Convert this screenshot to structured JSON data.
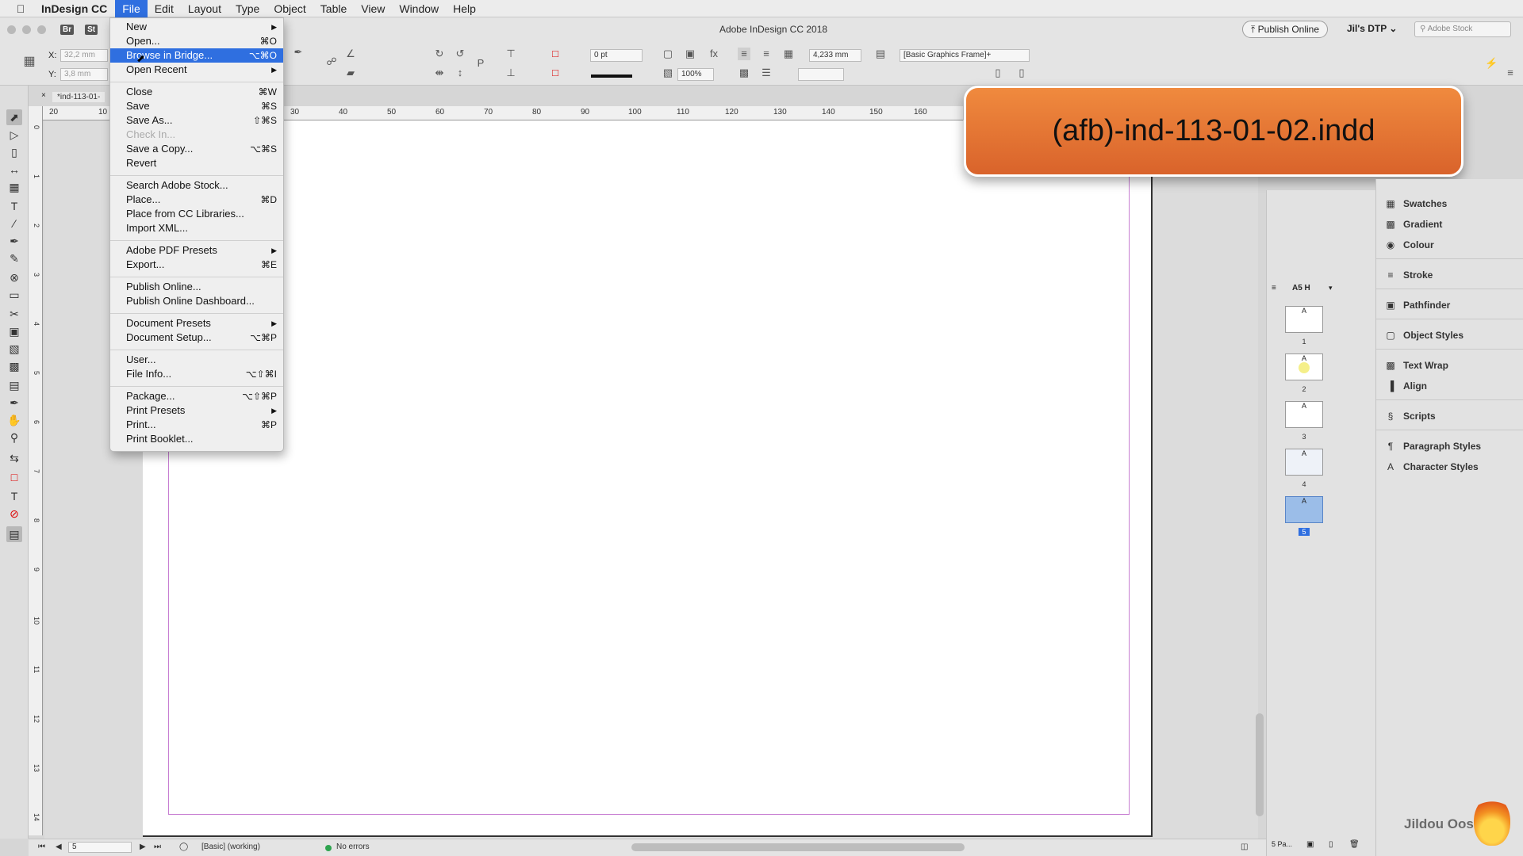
{
  "menubar": {
    "app_name": "InDesign CC",
    "items": [
      "File",
      "Edit",
      "Layout",
      "Type",
      "Object",
      "Table",
      "View",
      "Window",
      "Help"
    ]
  },
  "titlebar": {
    "title": "Adobe InDesign CC 2018",
    "publish_online": "Publish Online",
    "workspace": "Jil's DTP",
    "stock_placeholder": "Adobe Stock",
    "bridge_label": "Br",
    "stock_label": "St"
  },
  "control_panel": {
    "x_label": "X:",
    "x_value": "32,2 mm",
    "y_label": "Y:",
    "y_value": "3,8 mm",
    "stroke_weight": "0 pt",
    "opacity": "100%",
    "measure": "4,233 mm",
    "object_style": "[Basic Graphics Frame]+"
  },
  "document": {
    "tab_label": "*ind-113-01-",
    "ruler_ticks": [
      "20",
      "10",
      "30",
      "40",
      "50",
      "60",
      "70",
      "80",
      "90",
      "100",
      "110",
      "120",
      "130",
      "140",
      "150",
      "160"
    ],
    "vruler_ticks": [
      "0",
      "1",
      "2",
      "3",
      "4",
      "5",
      "6",
      "7",
      "8",
      "9",
      "10",
      "11",
      "12",
      "13",
      "14"
    ]
  },
  "file_menu": {
    "items": [
      {
        "label": "New",
        "shortcut": "",
        "submenu": true
      },
      {
        "label": "Open...",
        "shortcut": "⌘O"
      },
      {
        "label": "Browse in Bridge...",
        "shortcut": "⌥⌘O",
        "highlighted": true
      },
      {
        "label": "Open Recent",
        "shortcut": "",
        "submenu": true
      },
      {
        "label": "Close",
        "shortcut": "⌘W"
      },
      {
        "label": "Save",
        "shortcut": "⌘S"
      },
      {
        "label": "Save As...",
        "shortcut": "⇧⌘S"
      },
      {
        "label": "Check In...",
        "shortcut": "",
        "disabled": true
      },
      {
        "label": "Save a Copy...",
        "shortcut": "⌥⌘S"
      },
      {
        "label": "Revert",
        "shortcut": ""
      },
      {
        "label": "Search Adobe Stock...",
        "shortcut": ""
      },
      {
        "label": "Place...",
        "shortcut": "⌘D"
      },
      {
        "label": "Place from CC Libraries...",
        "shortcut": ""
      },
      {
        "label": "Import XML...",
        "shortcut": ""
      },
      {
        "label": "Adobe PDF Presets",
        "shortcut": "",
        "submenu": true
      },
      {
        "label": "Export...",
        "shortcut": "⌘E"
      },
      {
        "label": "Publish Online...",
        "shortcut": ""
      },
      {
        "label": "Publish Online Dashboard...",
        "shortcut": ""
      },
      {
        "label": "Document Presets",
        "shortcut": "",
        "submenu": true
      },
      {
        "label": "Document Setup...",
        "shortcut": "⌥⌘P"
      },
      {
        "label": "User...",
        "shortcut": ""
      },
      {
        "label": "File Info...",
        "shortcut": "⌥⇧⌘I"
      },
      {
        "label": "Package...",
        "shortcut": "⌥⇧⌘P"
      },
      {
        "label": "Print Presets",
        "shortcut": "",
        "submenu": true
      },
      {
        "label": "Print...",
        "shortcut": "⌘P"
      },
      {
        "label": "Print Booklet...",
        "shortcut": ""
      }
    ]
  },
  "badge": {
    "text": "(afb)-ind-113-01-02.indd"
  },
  "pages_panel": {
    "master_label": "A5 H",
    "pages": [
      {
        "number": "1",
        "master": "A"
      },
      {
        "number": "2",
        "master": "A"
      },
      {
        "number": "3",
        "master": "A"
      },
      {
        "number": "4",
        "master": "A"
      },
      {
        "number": "5",
        "master": "A"
      }
    ],
    "footer": "5 Pa..."
  },
  "right_panel": {
    "items": [
      "Swatches",
      "Gradient",
      "Colour",
      "Stroke",
      "Pathfinder",
      "Object Styles",
      "Text Wrap",
      "Align",
      "Scripts",
      "Paragraph Styles",
      "Character Styles"
    ]
  },
  "status_bar": {
    "page": "5",
    "preflight_profile": "[Basic] (working)",
    "errors": "No errors"
  },
  "watermark": {
    "text": "Jildou Oost"
  },
  "colors": {
    "menu_highlight": "#2f6fe0",
    "badge_orange": "#e8763a",
    "margin_guide": "#c77ed2",
    "status_ok": "#2ea44f"
  }
}
